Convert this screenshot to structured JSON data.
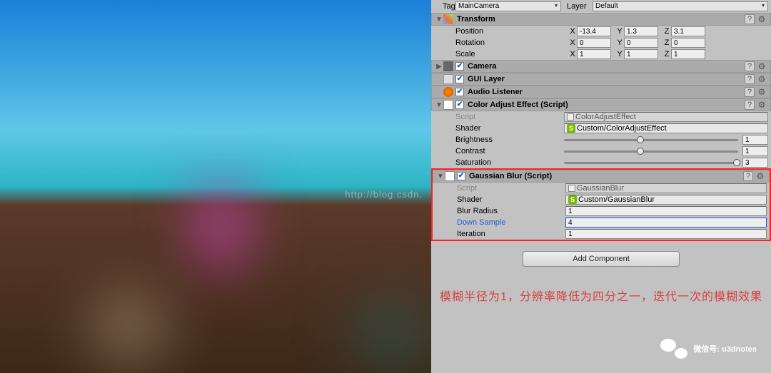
{
  "watermark": "http://blog.csdn.",
  "header": {
    "tag_label": "Tag",
    "tag_value": "MainCamera",
    "layer_label": "Layer",
    "layer_value": "Default"
  },
  "transform": {
    "title": "Transform",
    "position": {
      "label": "Position",
      "x": "-13.4",
      "y": "1.3",
      "z": "3.1"
    },
    "rotation": {
      "label": "Rotation",
      "x": "0",
      "y": "0",
      "z": "0"
    },
    "scale": {
      "label": "Scale",
      "x": "1",
      "y": "1",
      "z": "1"
    }
  },
  "camera": {
    "title": "Camera"
  },
  "guilayer": {
    "title": "GUI Layer"
  },
  "audio": {
    "title": "Audio Listener"
  },
  "coloradjust": {
    "title": "Color Adjust Effect (Script)",
    "script": {
      "label": "Script",
      "value": "ColorAdjustEffect"
    },
    "shader": {
      "label": "Shader",
      "value": "Custom/ColorAdjustEffect"
    },
    "brightness": {
      "label": "Brightness",
      "value": "1",
      "pct": 42
    },
    "contrast": {
      "label": "Contrast",
      "value": "1",
      "pct": 42
    },
    "saturation": {
      "label": "Saturation",
      "value": "3",
      "pct": 97
    }
  },
  "gaussian": {
    "title": "Gaussian Blur (Script)",
    "script": {
      "label": "Script",
      "value": "GaussianBlur"
    },
    "shader": {
      "label": "Shader",
      "value": "Custom/GaussianBlur"
    },
    "blur": {
      "label": "Blur Radius",
      "value": "1"
    },
    "down": {
      "label": "Down Sample",
      "value": "4"
    },
    "iter": {
      "label": "Iteration",
      "value": "1"
    }
  },
  "addcomp": "Add Component",
  "note": "模糊半径为1，分辨率降低为四分之一，迭代一次的模糊效果",
  "wechat": "微信号: u3dnotes",
  "axes": {
    "x": "X",
    "y": "Y",
    "z": "Z"
  }
}
